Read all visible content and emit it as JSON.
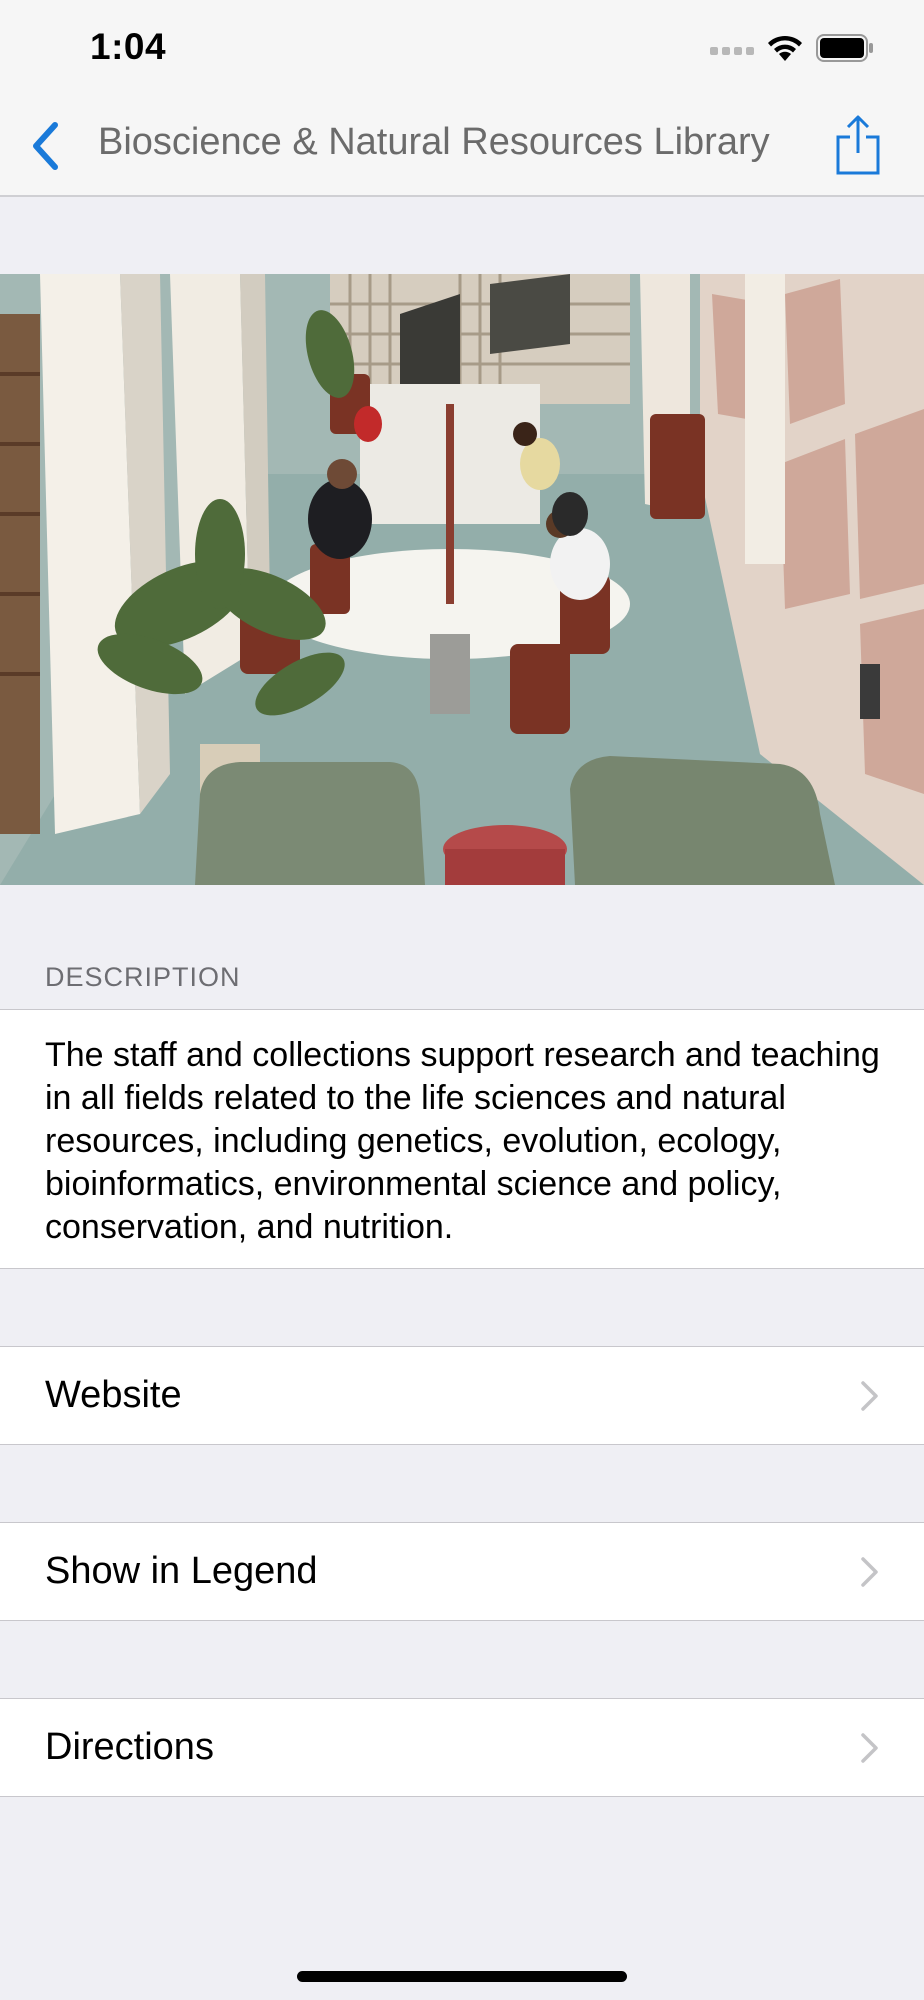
{
  "status_bar": {
    "time": "1:04"
  },
  "nav": {
    "title": "Bioscience & Natural Resources Library",
    "back_icon": "chevron-left-icon",
    "share_icon": "share-icon",
    "accent_color": "#1a7ad9"
  },
  "photo": {
    "subject": "library reading room photo"
  },
  "description": {
    "header": "DESCRIPTION",
    "text": "The staff and collections support research and teaching in all fields related to the life sciences and natural resources, including genetics, evolution, ecology, bioinformatics, environmental science and policy, conservation, and nutrition."
  },
  "rows": [
    {
      "label": "Website"
    },
    {
      "label": "Show in Legend"
    },
    {
      "label": "Directions"
    }
  ]
}
